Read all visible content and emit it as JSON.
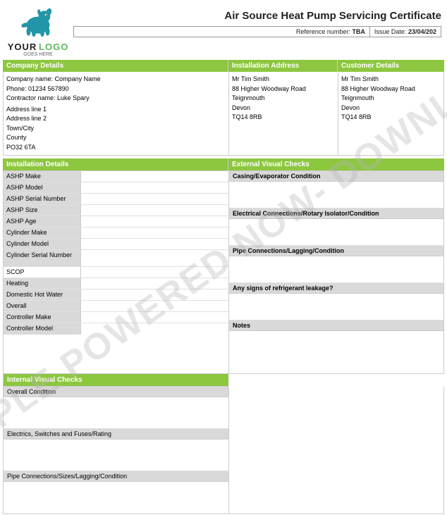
{
  "header": {
    "logo": {
      "your": "YOUR",
      "logo": "LOGO",
      "goes": "GOES HERE"
    },
    "title": "Air Source Heat Pump Servicing Certificate",
    "reference_label": "Reference number:",
    "reference_value": "TBA",
    "issue_label": "Issue Date:",
    "issue_value": "23/04/202"
  },
  "company_section": {
    "header": "Company Details",
    "name_label": "Company name:",
    "name_value": "Company Name",
    "phone_label": "Phone:",
    "phone_value": "01234 567890",
    "contractor_label": "Contractor name:",
    "contractor_value": "Luke Spary",
    "address_line1": "Address line 1",
    "address_line2": "Address line 2",
    "town": "Town/City",
    "county": "County",
    "postcode": "PO32 6TA"
  },
  "installation_address": {
    "header": "Installation Address",
    "name": "Mr Tim Smith",
    "address1": "88 Higher Woodway Road",
    "town": "Teignmouth",
    "county": "Devon",
    "postcode": "TQ14 8RB"
  },
  "customer_details": {
    "header": "Customer Details",
    "name": "Mr Tim Smith",
    "address1": "88 Higher Woodway Road",
    "town": "Teignmouth",
    "county": "Devon",
    "postcode": "TQ14 8RB"
  },
  "installation_details": {
    "header": "Installation Details",
    "fields": [
      {
        "label": "ASHP Make",
        "value": ""
      },
      {
        "label": "ASHP Model",
        "value": ""
      },
      {
        "label": "ASHP Serial Number",
        "value": ""
      },
      {
        "label": "ASHP Size",
        "value": ""
      },
      {
        "label": "ASHP Age",
        "value": ""
      },
      {
        "label": "Cylinder Make",
        "value": ""
      },
      {
        "label": "Cylinder Model",
        "value": ""
      },
      {
        "label": "Cylinder Serial Number",
        "value": ""
      },
      {
        "label": "SCOP",
        "value": ""
      },
      {
        "label": "Heating",
        "value": ""
      },
      {
        "label": "Domestic Hot Water",
        "value": ""
      },
      {
        "label": "Overall",
        "value": ""
      },
      {
        "label": "Controller Make",
        "value": ""
      },
      {
        "label": "Controller Model",
        "value": ""
      }
    ]
  },
  "external_visual_checks": {
    "header": "External Visual Checks",
    "sections": [
      {
        "label": "Casing/Evaporator Condition",
        "value": ""
      },
      {
        "label": "Electrical Connections/Rotary Isolator/Condition",
        "value": ""
      },
      {
        "label": "Pipe Connections/Lagging/Condition",
        "value": ""
      },
      {
        "label": "Any signs of refrigerant leakage?",
        "value": ""
      },
      {
        "label": "Notes",
        "value": ""
      }
    ]
  },
  "internal_visual_checks": {
    "header": "Internal Visual Checks",
    "sections": [
      {
        "label": "Overall Condition",
        "value": ""
      },
      {
        "label": "Electrics, Switches and Fuses/Rating",
        "value": ""
      },
      {
        "label": "Pipe Connections/Sizes/Lagging/Condition",
        "value": ""
      }
    ]
  },
  "watermark": "SAMPLE POWERED NOW- DOWNLOAD"
}
